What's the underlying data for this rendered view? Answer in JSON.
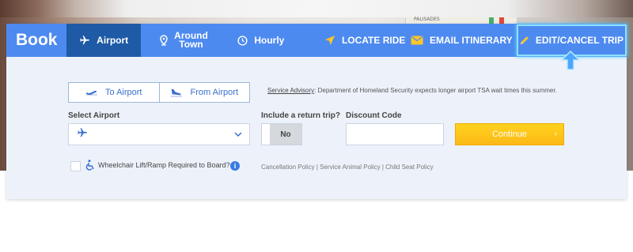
{
  "nav": {
    "brand": "Book",
    "tabs": {
      "airport": "Airport",
      "around_town_line1": "Around",
      "around_town_line2": "Town",
      "hourly": "Hourly",
      "locate_ride": "LOCATE RIDE",
      "email_itinerary": "EMAIL ITINERARY",
      "edit_cancel": "EDIT/CANCEL TRIP"
    },
    "active_tab": "airport"
  },
  "map_label": "PALISADES",
  "direction": {
    "to_airport": "To Airport",
    "from_airport": "From Airport"
  },
  "advisory": {
    "link": "Service Advisory",
    "text": ": Department of Homeland Security expects longer airport TSA wait times this summer."
  },
  "form": {
    "select_airport_label": "Select Airport",
    "select_airport_value": "",
    "return_trip_label": "Include a return trip?",
    "return_trip_value": "No",
    "discount_label": "Discount Code",
    "discount_value": "",
    "continue_label": "Continue",
    "continue_chevron": "›"
  },
  "accessibility": {
    "wheelchair_label": "Wheelchair Lift/Ramp Required to Board?",
    "info_symbol": "i"
  },
  "policies": {
    "cancellation": "Cancellation Policy",
    "separator": " | ",
    "service_animal": "Service Animal Policy",
    "child_seat": "Child Seat Policy"
  },
  "colors": {
    "nav_bg": "#4d8af0",
    "active_tab_bg": "#1f5aa6",
    "card_bg": "#edf2fa",
    "continue_bg": "#fcb917",
    "highlight_border": "#8fe0ff"
  }
}
